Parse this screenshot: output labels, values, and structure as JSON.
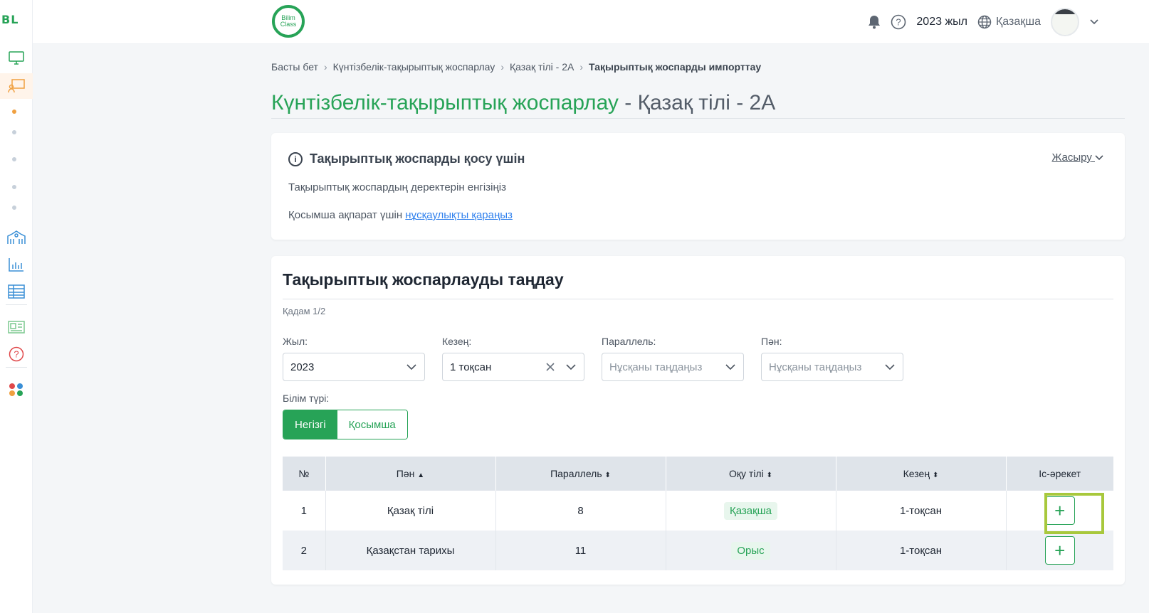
{
  "sidebar": {
    "logo": "BL",
    "collapse_icon": "chevron-right-icon"
  },
  "header": {
    "brand_text": "Bilim Class",
    "year": "2023 жыл",
    "language": "Қазақша"
  },
  "breadcrumb": [
    "Басты бет",
    "Күнтізбелік-тақырыптық жоспарлау",
    "Қазақ тілі - 2А",
    "Тақырыптық жоспарды импорттау"
  ],
  "page": {
    "title_main": "Күнтізбелік-тақырыптық жоспарлау",
    "title_rest": " - Қазақ тілі - 2А"
  },
  "info": {
    "heading": "Тақырыптық жоспарды қосу үшін",
    "hide_label": "Жасыру",
    "line1": "Тақырыптық жоспардың деректерін енгізіңіз",
    "line2_prefix": "Қосымша ақпарат үшін ",
    "line2_link": "нұсқаулықты қараңыз"
  },
  "form": {
    "title": "Тақырыптық жоспарлауды таңдау",
    "step": "Қадам 1/2",
    "year_label": "Жыл:",
    "year_value": "2023",
    "period_label": "Кезең:",
    "period_value": "1 тоқсан",
    "parallel_label": "Параллель:",
    "parallel_placeholder": "Нұсқаны таңдаңыз",
    "subject_label": "Пән:",
    "subject_placeholder": "Нұсқаны таңдаңыз",
    "edu_type_label": "Білім түрі:",
    "edu_main": "Негізгі",
    "edu_extra": "Қосымша"
  },
  "table": {
    "headers": {
      "no": "№",
      "subject": "Пән",
      "parallel": "Параллель",
      "language": "Оқу тілі",
      "period": "Кезең",
      "action": "Іс-әрекет"
    },
    "rows": [
      {
        "no": "1",
        "subject": "Қазақ тілі",
        "parallel": "8",
        "language": "Қазақша",
        "period": "1-тоқсан"
      },
      {
        "no": "2",
        "subject": "Қазақстан тарихы",
        "parallel": "11",
        "language": "Орыс",
        "period": "1-тоқсан"
      }
    ],
    "add_symbol": "+"
  },
  "colors": {
    "accent": "#27a357",
    "highlight": "#a8c83c"
  }
}
